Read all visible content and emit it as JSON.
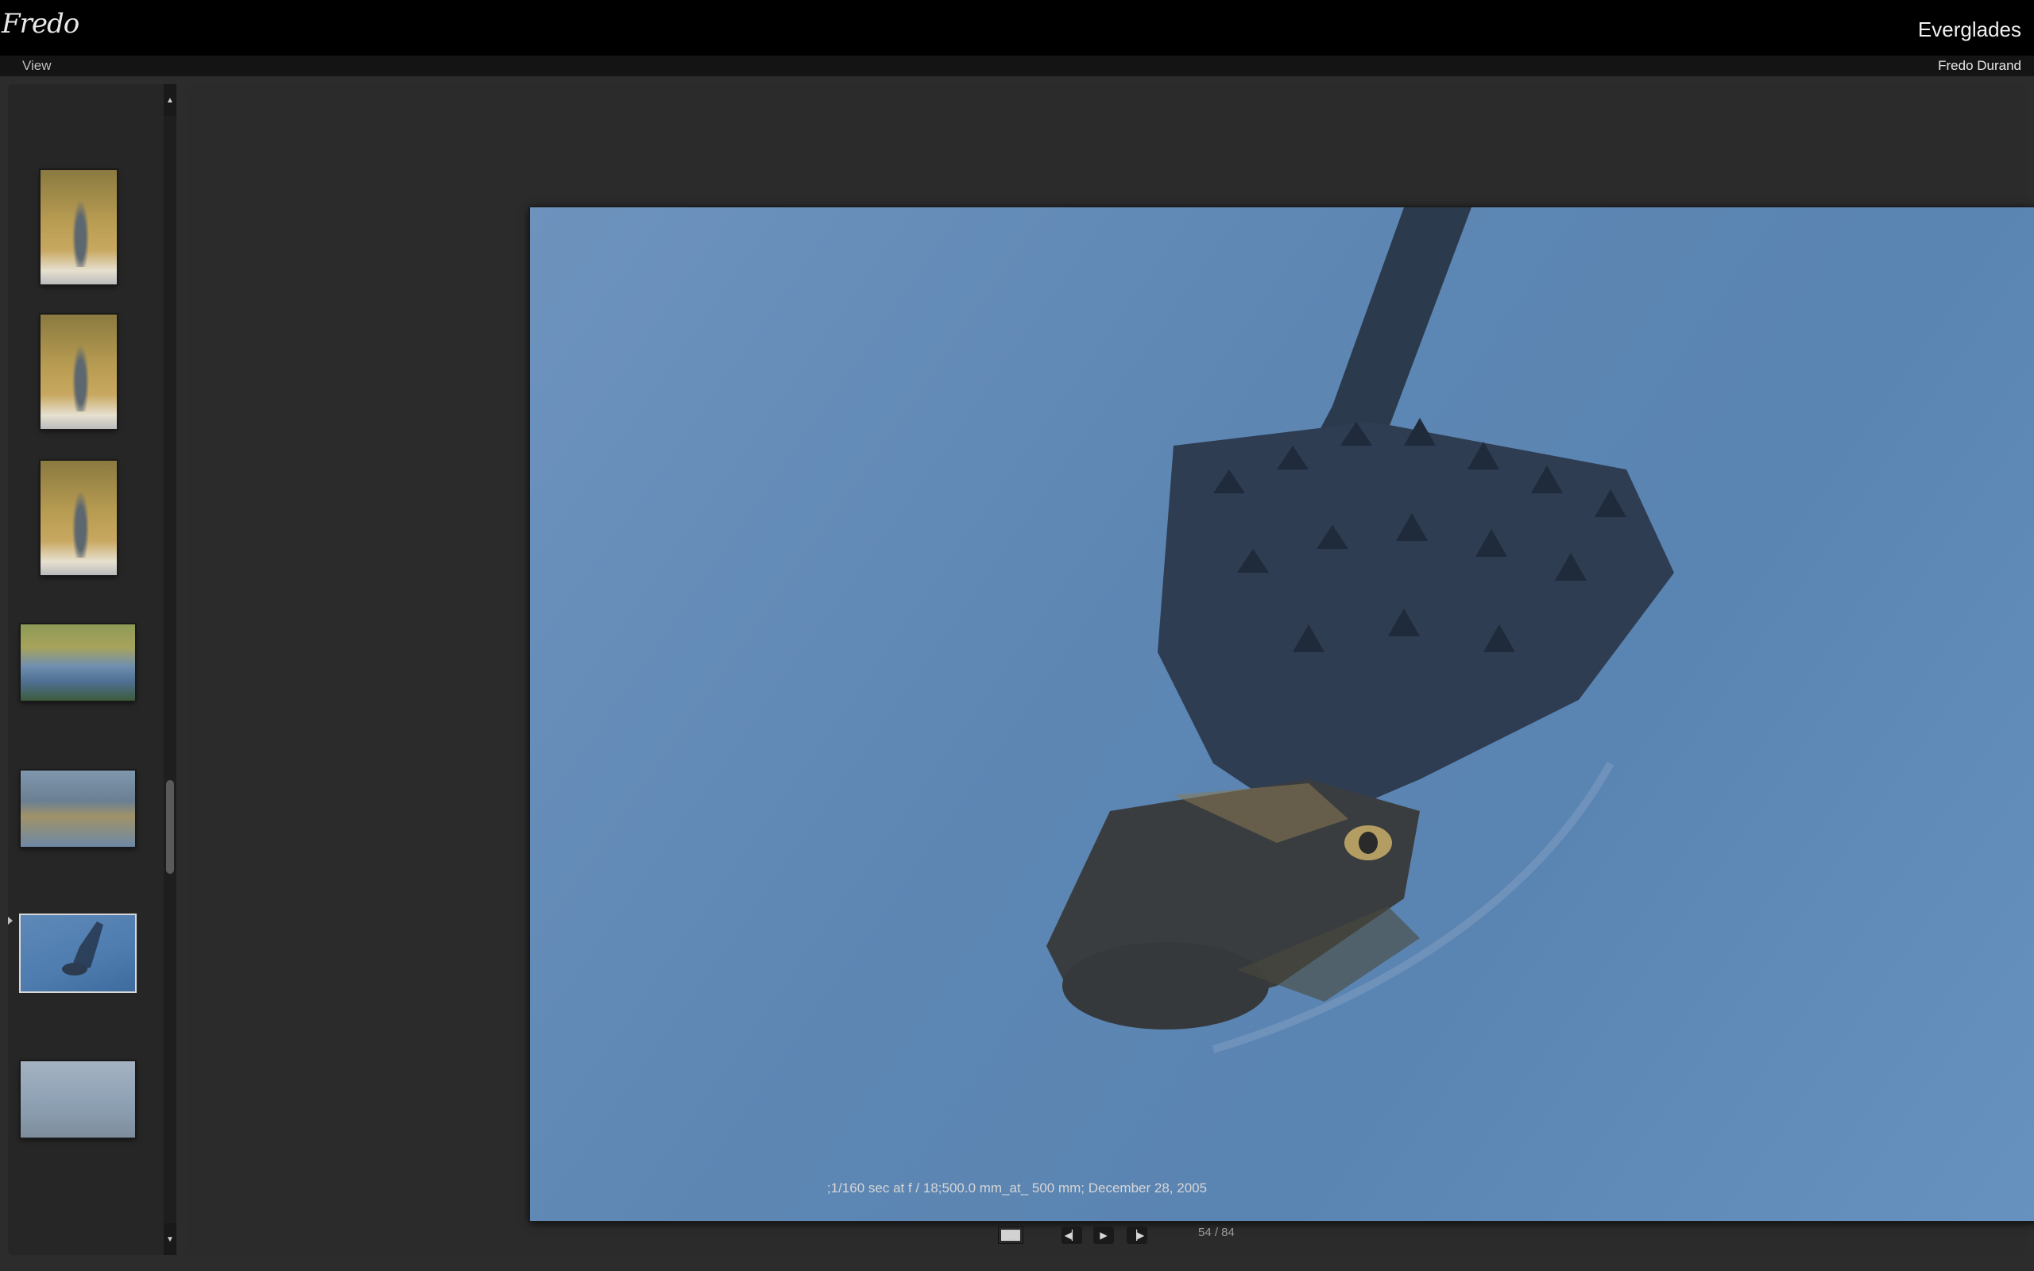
{
  "header": {
    "logo": "Fredo",
    "gallery_title": "Everglades"
  },
  "menu": {
    "view_label": "View",
    "author": "Fredo Durand"
  },
  "sidebar": {
    "thumbnails": [
      {
        "name": "heron-1",
        "selected": false
      },
      {
        "name": "heron-2",
        "selected": false
      },
      {
        "name": "heron-3",
        "selected": false
      },
      {
        "name": "marsh",
        "selected": false
      },
      {
        "name": "alligator-small",
        "selected": false
      },
      {
        "name": "alligator",
        "selected": true
      },
      {
        "name": "anhinga",
        "selected": false
      }
    ]
  },
  "photo": {
    "caption": ";1/160 sec at f / 18;500.0 mm_at_ 500 mm; December 28, 2005"
  },
  "controls": {
    "counter": "54 / 84",
    "icons": [
      "single-view-icon",
      "previous-icon",
      "play-icon",
      "next-icon"
    ]
  },
  "colors": {
    "background": "#2c2c2c",
    "topbar": "#000000",
    "water": "#5d86b3"
  }
}
